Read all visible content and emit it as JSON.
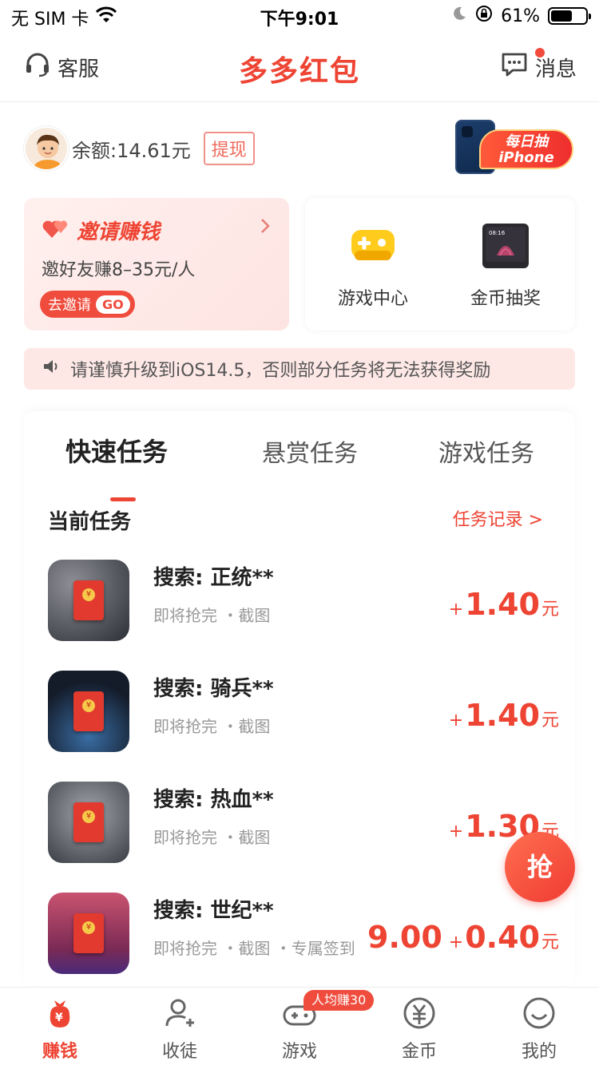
{
  "status_bar": {
    "carrier": "无 SIM 卡",
    "time": "下午9:01",
    "battery_pct": "61%",
    "battery_level": 0.61
  },
  "header": {
    "customer_service": "客服",
    "title": "多多红包",
    "messages": "消息"
  },
  "account": {
    "balance": "余额:14.61元",
    "withdraw": "提现",
    "promo_line1": "每日抽",
    "promo_line2": "iPhone"
  },
  "invite": {
    "title": "邀请赚钱",
    "subtitle": "邀好友赚8–35元/人",
    "button": "去邀请",
    "go": "GO"
  },
  "tools": [
    {
      "label": "游戏中心",
      "icon": "gamepad-icon"
    },
    {
      "label": "金币抽奖",
      "icon": "smart-display-icon"
    }
  ],
  "notice": "请谨慎升级到iOS14.5，否则部分任务将无法获得奖励",
  "tabs": [
    "快速任务",
    "悬赏任务",
    "游戏任务"
  ],
  "active_tab": 0,
  "section": {
    "title": "当前任务",
    "link": "任务记录 >"
  },
  "tasks": [
    {
      "name": "搜索: 正统**",
      "meta": "即将抢完 ・截图",
      "plus": "+",
      "value": "1.40",
      "unit": "元",
      "extra": "",
      "thumb_color": "#3b3f49"
    },
    {
      "name": "搜索: 骑兵**",
      "meta": "即将抢完 ・截图",
      "plus": "+",
      "value": "1.40",
      "unit": "元",
      "extra": "",
      "thumb_color": "#1f2c40"
    },
    {
      "name": "搜索: 热血**",
      "meta": "即将抢完 ・截图",
      "plus": "+",
      "value": "1.30",
      "unit": "元",
      "extra": "",
      "thumb_color": "#5a5e66"
    },
    {
      "name": "搜索: 世纪**",
      "meta": "即将抢完 ・截图 ・专属签到",
      "plus": "+",
      "value": "0.40",
      "unit": "元",
      "extra": "9.00",
      "thumb_color": "#8f3d57"
    }
  ],
  "grab_button": "抢",
  "bottom_nav": [
    {
      "label": "赚钱",
      "icon": "money-bag-icon"
    },
    {
      "label": "收徒",
      "icon": "add-user-icon"
    },
    {
      "label": "游戏",
      "icon": "controller-icon"
    },
    {
      "label": "金币",
      "icon": "coin-icon"
    },
    {
      "label": "我的",
      "icon": "smiley-icon"
    }
  ],
  "nav_badge": "人均赚30",
  "colors": {
    "accent": "#ee4433",
    "notice_bg": "#fde8e6",
    "invite_bg": "#fdeaea"
  }
}
